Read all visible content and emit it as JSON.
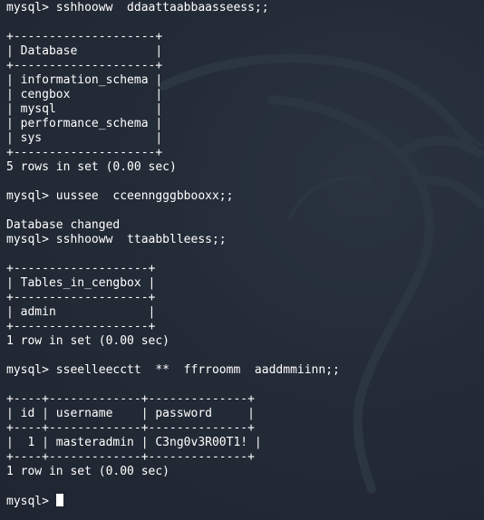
{
  "terminal": {
    "lines": [
      "mysql> sshhooww  ddaattaabbaasseess;;",
      "",
      "+--------------------+",
      "| Database           |",
      "+--------------------+",
      "| information_schema |",
      "| cengbox            |",
      "| mysql              |",
      "| performance_schema |",
      "| sys                |",
      "+--------------------+",
      "5 rows in set (0.00 sec)",
      "",
      "mysql> uussee  cceenngggbbooxx;;",
      "",
      "Database changed",
      "mysql> sshhooww  ttaabblleess;;",
      "",
      "+-------------------+",
      "| Tables_in_cengbox |",
      "+-------------------+",
      "| admin             |",
      "+-------------------+",
      "1 row in set (0.00 sec)",
      "",
      "mysql> sseelleecctt  **  ffrroomm  aaddmmiinn;;",
      "",
      "+----+-------------+--------------+",
      "| id | username    | password     |",
      "+----+-------------+--------------+",
      "|  1 | masteradmin | C3ng0v3R00T1! |",
      "+----+-------------+--------------+",
      "1 row in set (0.00 sec)",
      "",
      "mysql> "
    ]
  },
  "colors": {
    "background": "#222a36",
    "text": "#ffffff",
    "logo": "#2c3542"
  },
  "icons": {
    "background": "kali-dragon-logo-icon",
    "cursor": "block-cursor"
  }
}
